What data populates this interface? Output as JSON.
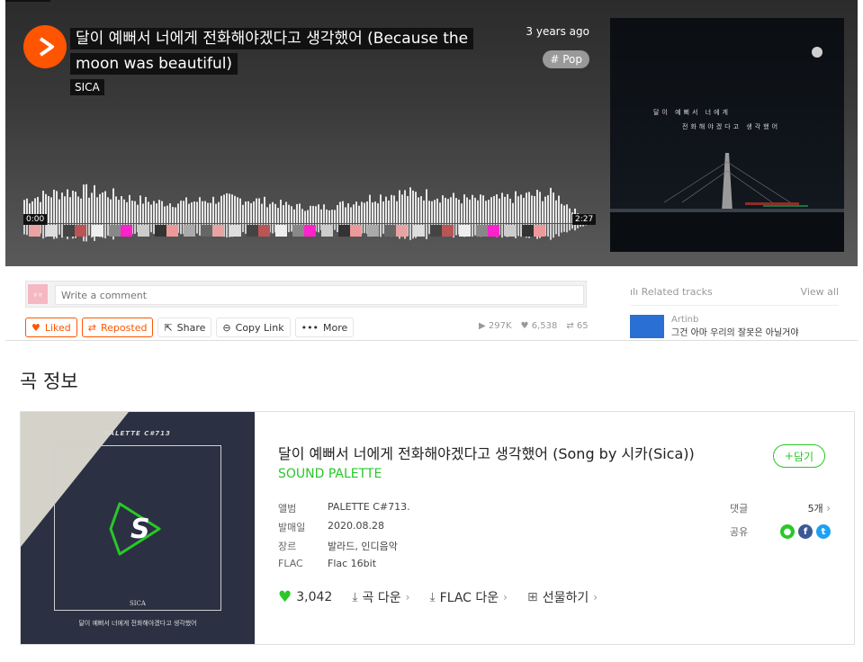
{
  "player": {
    "title_line1": "달이 예뻐서 너에게 전화해야겠다고 생각했어 (Because the",
    "title_line2": "moon was beautiful)",
    "artist": "SICA",
    "posted": "3 years ago",
    "genre": "# Pop",
    "time_start": "0:00",
    "time_end": "2:27",
    "cover_text_line1": "달이 예뻐서 너에게",
    "cover_text_line2": "전화해야겠다고 생각했어",
    "accent": "#ff5500"
  },
  "comment": {
    "avatar_text": "ㅎㅎ",
    "placeholder": "Write a comment"
  },
  "actions": {
    "liked": "Liked",
    "reposted": "Reposted",
    "share": "Share",
    "copy_link": "Copy Link",
    "more": "More"
  },
  "stats": {
    "plays": "297K",
    "likes": "6,538",
    "reposts": "65"
  },
  "related": {
    "header": "Related tracks",
    "view_all": "View all",
    "item_artist": "Artinb",
    "item_title": "그건 아마 우리의 잘못은 아닐거야"
  },
  "song_info": {
    "section_title": "곡 정보",
    "title": "달이 예뻐서 너에게 전화해야겠다고 생각했어 (Song by 시카(Sica))",
    "artist": "SOUND PALETTE",
    "add_label": "담기",
    "album_art": {
      "palette": "PALETTE C#713",
      "sica": "SICA",
      "caption": "달이 예뻐서 너에게 전화해야겠다고 생각했어"
    },
    "meta": [
      {
        "label": "앨범",
        "value": "PALETTE C#713."
      },
      {
        "label": "발매일",
        "value": "2020.08.28"
      },
      {
        "label": "장르",
        "value": "발라드, 인디음악"
      },
      {
        "label": "FLAC",
        "value": "Flac 16bit"
      }
    ],
    "comments_label": "댓글",
    "comments_value": "5개",
    "share_label": "공유",
    "likes": "3,042",
    "song_download": "곡 다운",
    "flac_download": "FLAC 다운",
    "gift": "선물하기",
    "green": "#28c828"
  }
}
